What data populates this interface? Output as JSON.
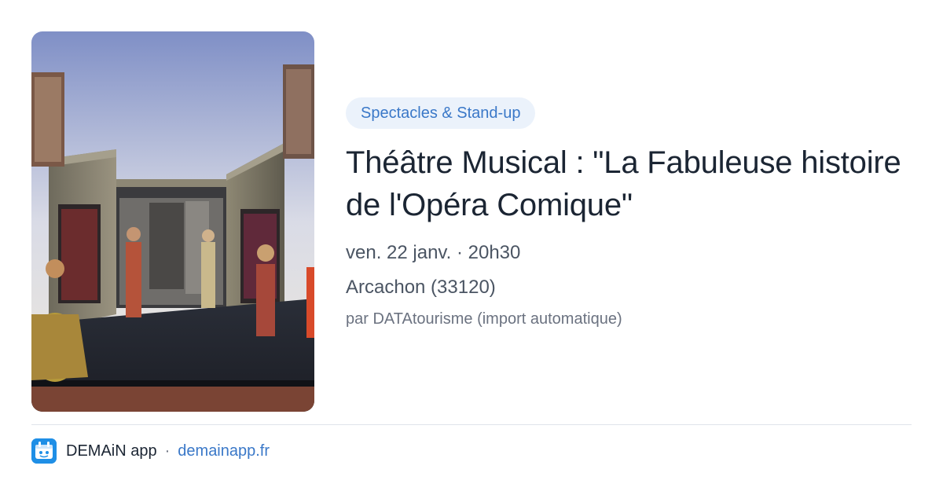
{
  "event": {
    "category": "Spectacles & Stand-up",
    "title": "Théâtre Musical : \"La Fabuleuse histoire de l'Opéra Comique\"",
    "datetime": "ven. 22 janv. · 20h30",
    "location": "Arcachon (33120)",
    "source": "par DATAtourisme (import automatique)"
  },
  "image": {
    "subject": "theater-stage-model-photo"
  },
  "footer": {
    "app_name": "DEMAiN app",
    "separator": "·",
    "url": "demainapp.fr",
    "logo_icon": "demain-app-logo-icon"
  },
  "colors": {
    "accent": "#3a78c8",
    "badge_bg": "#ebf2fb",
    "title": "#1b2533",
    "meta": "#4b5563",
    "logo_bg": "#1f8fe6"
  }
}
